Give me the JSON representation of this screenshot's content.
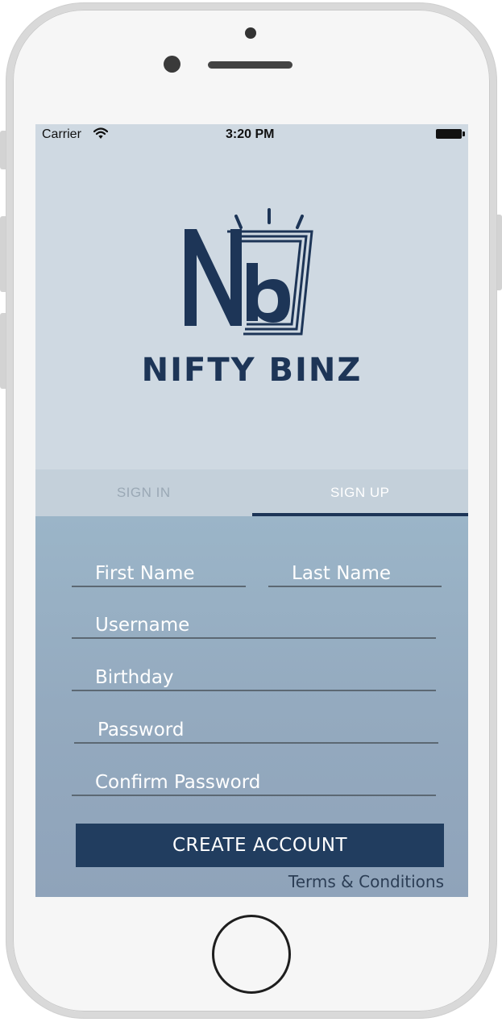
{
  "status_bar": {
    "carrier": "Carrier",
    "time": "3:20 PM",
    "wifi_icon": "wifi-icon",
    "battery_icon": "battery-full-icon"
  },
  "brand": {
    "name": "NIFTY BINZ",
    "logo_letters": "Nb",
    "color": "#1d3557"
  },
  "tabs": [
    {
      "label": "SIGN IN",
      "active": false
    },
    {
      "label": "SIGN UP",
      "active": true
    }
  ],
  "form": {
    "first_name": {
      "placeholder": "First Name",
      "value": ""
    },
    "last_name": {
      "placeholder": "Last Name",
      "value": ""
    },
    "username": {
      "placeholder": "Username",
      "value": ""
    },
    "birthday": {
      "placeholder": "Birthday",
      "value": ""
    },
    "password": {
      "placeholder": "Password",
      "value": ""
    },
    "confirm_password": {
      "placeholder": "Confirm Password",
      "value": ""
    },
    "submit_label": "CREATE ACCOUNT",
    "terms_link": "Terms & Conditions"
  },
  "colors": {
    "accent": "#1d3557",
    "button": "#213d5f",
    "header_bg": "#cfd9e2",
    "form_bg": "#9bb5c8"
  }
}
